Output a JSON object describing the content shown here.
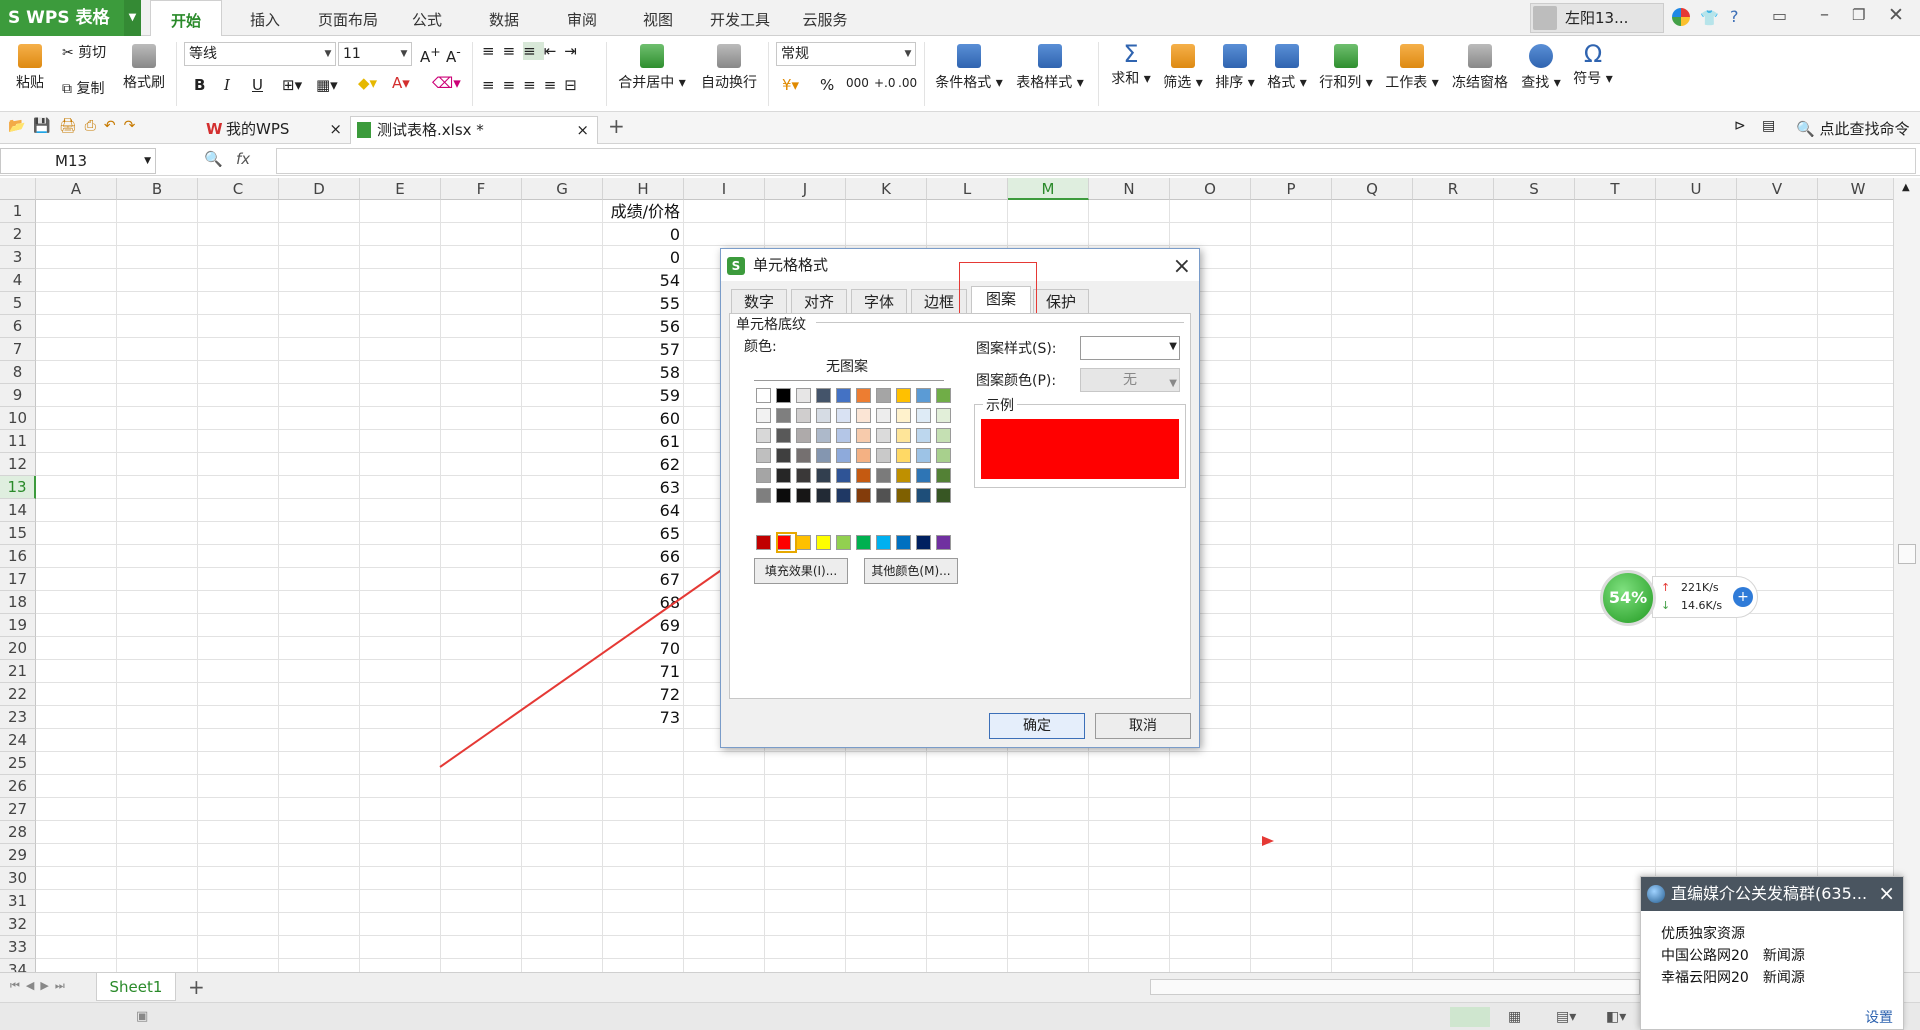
{
  "app": {
    "logo_text": "S WPS 表格",
    "ribbon_tabs": [
      "开始",
      "插入",
      "页面布局",
      "公式",
      "数据",
      "审阅",
      "视图",
      "开发工具",
      "云服务"
    ],
    "user_name": "左阳13..."
  },
  "ribbon": {
    "paste": "粘贴",
    "cut": "剪切",
    "copy": "复制",
    "format_painter": "格式刷",
    "font_name": "等线",
    "font_size": "11",
    "bold": "B",
    "italic": "I",
    "underline": "U",
    "merge_center": "合并居中",
    "wrap_text": "自动换行",
    "number_format": "常规",
    "percent": "%",
    "cond_format": "条件格式",
    "table_style": "表格样式",
    "sum": "求和",
    "filter": "筛选",
    "sort": "排序",
    "format": "格式",
    "row_col": "行和列",
    "worksheet": "工作表",
    "freeze": "冻结窗格",
    "find": "查找",
    "symbol": "符号",
    "sum_icon": "Σ",
    "symbol_icon": "Ω"
  },
  "docbar": {
    "tab1": "我的WPS",
    "tab2": "测试表格.xlsx *",
    "search_cmd": "点此查找命令"
  },
  "formula_bar": {
    "name_box": "M13",
    "fx": "fx",
    "formula": ""
  },
  "columns": [
    "A",
    "B",
    "C",
    "D",
    "E",
    "F",
    "G",
    "H",
    "I",
    "J",
    "K",
    "L",
    "M",
    "N",
    "O",
    "P",
    "Q",
    "R",
    "S",
    "T",
    "U",
    "V",
    "W"
  ],
  "rows": [
    "1",
    "2",
    "3",
    "4",
    "5",
    "6",
    "7",
    "8",
    "9",
    "10",
    "11",
    "12",
    "13",
    "14",
    "15",
    "16",
    "17",
    "18",
    "19",
    "20",
    "21",
    "22",
    "23",
    "24",
    "25",
    "26",
    "27",
    "28",
    "29",
    "30",
    "31",
    "32",
    "33",
    "34"
  ],
  "cells": {
    "H1": "成绩/价格",
    "H_values": [
      "0",
      "0",
      "54",
      "55",
      "56",
      "57",
      "58",
      "59",
      "60",
      "61",
      "62",
      "63",
      "64",
      "65",
      "66",
      "67",
      "68",
      "69",
      "70",
      "71",
      "72",
      "73"
    ]
  },
  "sheet": {
    "tab_name": "Sheet1",
    "add": "+"
  },
  "dialog": {
    "title": "单元格格式",
    "tabs": [
      "数字",
      "对齐",
      "字体",
      "边框",
      "图案",
      "保护"
    ],
    "active_tab": "图案",
    "section": "单元格底纹",
    "color_label": "颜色:",
    "no_pattern": "无图案",
    "fill_effects": "填充效果(I)...",
    "more_colors": "其他颜色(M)...",
    "pattern_style_label": "图案样式(S):",
    "pattern_color_label": "图案颜色(P):",
    "pattern_color_value": "无",
    "preview_label": "示例",
    "preview_color": "#ff0000",
    "ok": "确定",
    "cancel": "取消",
    "palette_top": [
      "#ffffff",
      "#000000",
      "#e7e6e6",
      "#44546a",
      "#4472c4",
      "#ed7d31",
      "#a5a5a5",
      "#ffc000",
      "#5b9bd5",
      "#70ad47"
    ],
    "palette_shades": [
      [
        "#f2f2f2",
        "#7f7f7f",
        "#d0cece",
        "#d6dce4",
        "#d9e2f3",
        "#fbe5d5",
        "#ededed",
        "#fff2cc",
        "#deebf6",
        "#e2efd9"
      ],
      [
        "#d8d8d8",
        "#595959",
        "#aeaaaa",
        "#adb9ca",
        "#b4c6e7",
        "#f7cbac",
        "#dbdbdb",
        "#fee599",
        "#bdd7ee",
        "#c5e0b3"
      ],
      [
        "#bfbfbf",
        "#3f3f3f",
        "#757070",
        "#8496b0",
        "#8eaadb",
        "#f4b183",
        "#c9c9c9",
        "#ffd965",
        "#9dc3e6",
        "#a8d08d"
      ],
      [
        "#a5a5a5",
        "#262626",
        "#3a3838",
        "#323f4f",
        "#2f5496",
        "#c55a11",
        "#7b7b7b",
        "#bf9000",
        "#2e75b5",
        "#538135"
      ],
      [
        "#7f7f7f",
        "#0c0c0c",
        "#171616",
        "#222a35",
        "#1f3864",
        "#833c0b",
        "#525252",
        "#7f6000",
        "#1e4e79",
        "#375623"
      ]
    ],
    "palette_standard": [
      "#c00000",
      "#ff0000",
      "#ffc000",
      "#ffff00",
      "#92d050",
      "#00b050",
      "#00b0f0",
      "#0070c0",
      "#002060",
      "#7030a0"
    ]
  },
  "net_widget": {
    "percent": "54%",
    "up": "221K/s",
    "down": "14.6K/s"
  },
  "notification": {
    "title": "直编媒介公关发稿群(635...",
    "lines": [
      "优质独家资源",
      "中国公路网20　新闻源",
      "幸福云阳网20　新闻源"
    ],
    "settings": "设置"
  },
  "accent_color": "#3c9b3c",
  "annotation_color": "#e53935"
}
